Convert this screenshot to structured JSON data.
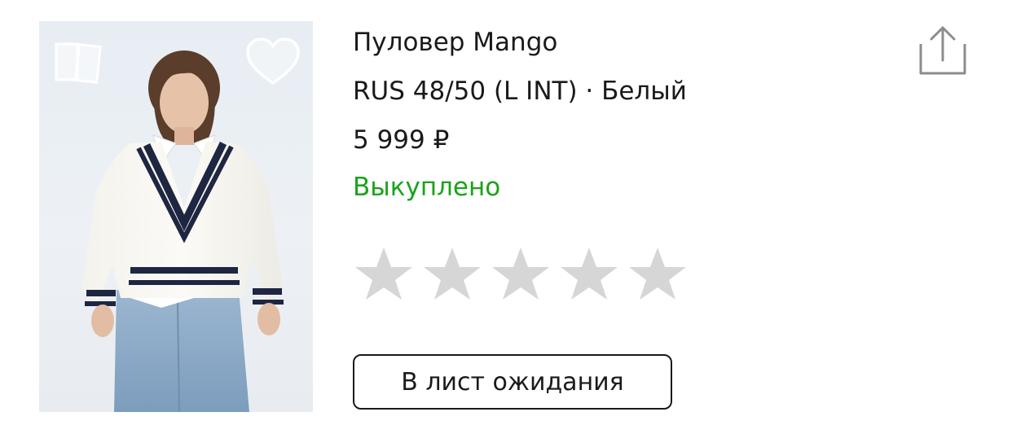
{
  "product": {
    "title": "Пуловер Mango",
    "variant": "RUS 48/50 (L INT) · Белый",
    "price": "5 999 ₽",
    "status": "Выкуплено",
    "image_alt": "Белый пуловер с тёмно-синей полосой"
  },
  "rating": {
    "value": 0,
    "max": 5
  },
  "actions": {
    "waitlist_label": "В лист ожидания"
  },
  "icons": {
    "compare": "compare-cards-icon",
    "favorite": "heart-outline-icon",
    "share": "share-icon",
    "star": "star-icon"
  },
  "colors": {
    "status": "#1aa31a",
    "star_empty": "#d6d6d6",
    "text": "#1a1a1a",
    "icon_gray": "#8c8c8c"
  }
}
